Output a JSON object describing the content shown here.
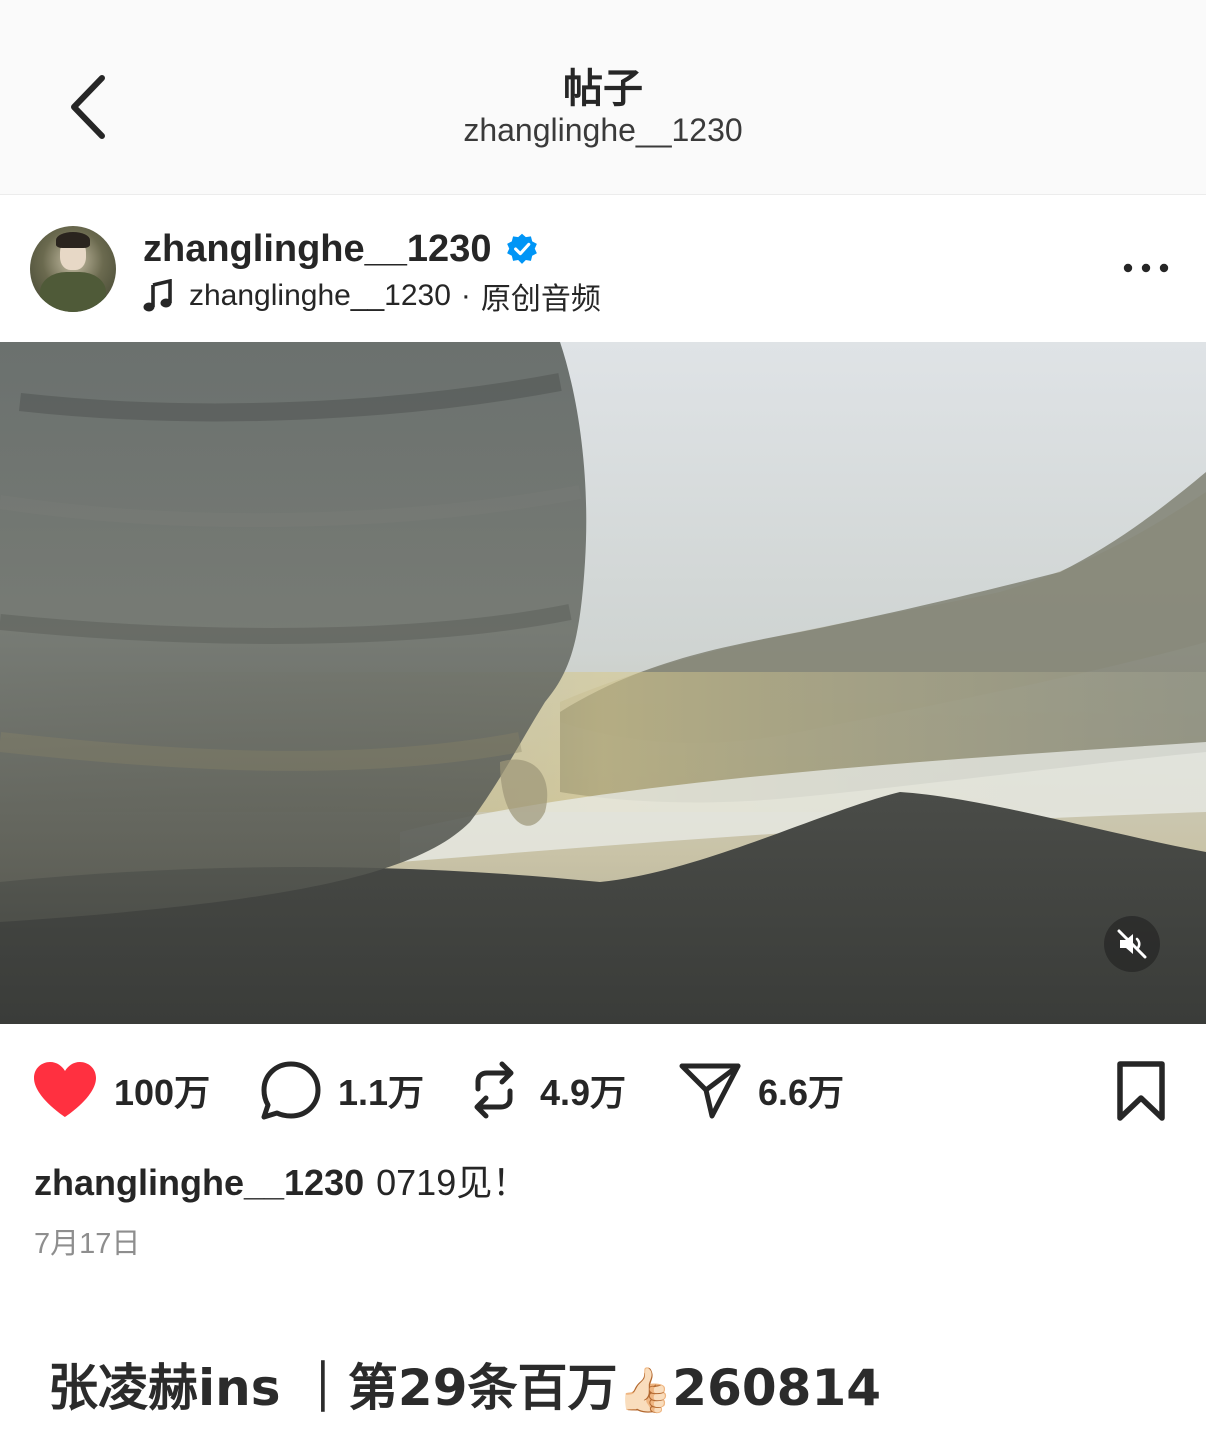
{
  "header": {
    "title": "帖子",
    "subtitle": "zhanglinghe__1230"
  },
  "post": {
    "username": "zhanglinghe__1230",
    "verified": true,
    "audio": {
      "artist": "zhanglinghe__1230",
      "separator": "·",
      "label": "原创音频"
    },
    "media": {
      "type": "video",
      "muted": true
    }
  },
  "actions": {
    "likes": "100万",
    "comments": "1.1万",
    "reposts": "4.9万",
    "shares": "6.6万",
    "like_color": "#ff3040"
  },
  "caption": {
    "username": "zhanglinghe__1230",
    "text": "0719见！"
  },
  "date": "7月17日",
  "footer": {
    "prefix": "张凌赫ins ｜第29条百万",
    "emoji": "👍🏻",
    "suffix": "260814"
  },
  "icons": {
    "back": "chevron-left-icon",
    "verified": "verified-badge-icon",
    "music": "music-note-icon",
    "more": "more-horizontal-icon",
    "mute": "speaker-muted-icon",
    "like": "heart-icon",
    "comment": "comment-icon",
    "repost": "repost-icon",
    "share": "send-icon",
    "bookmark": "bookmark-icon"
  }
}
